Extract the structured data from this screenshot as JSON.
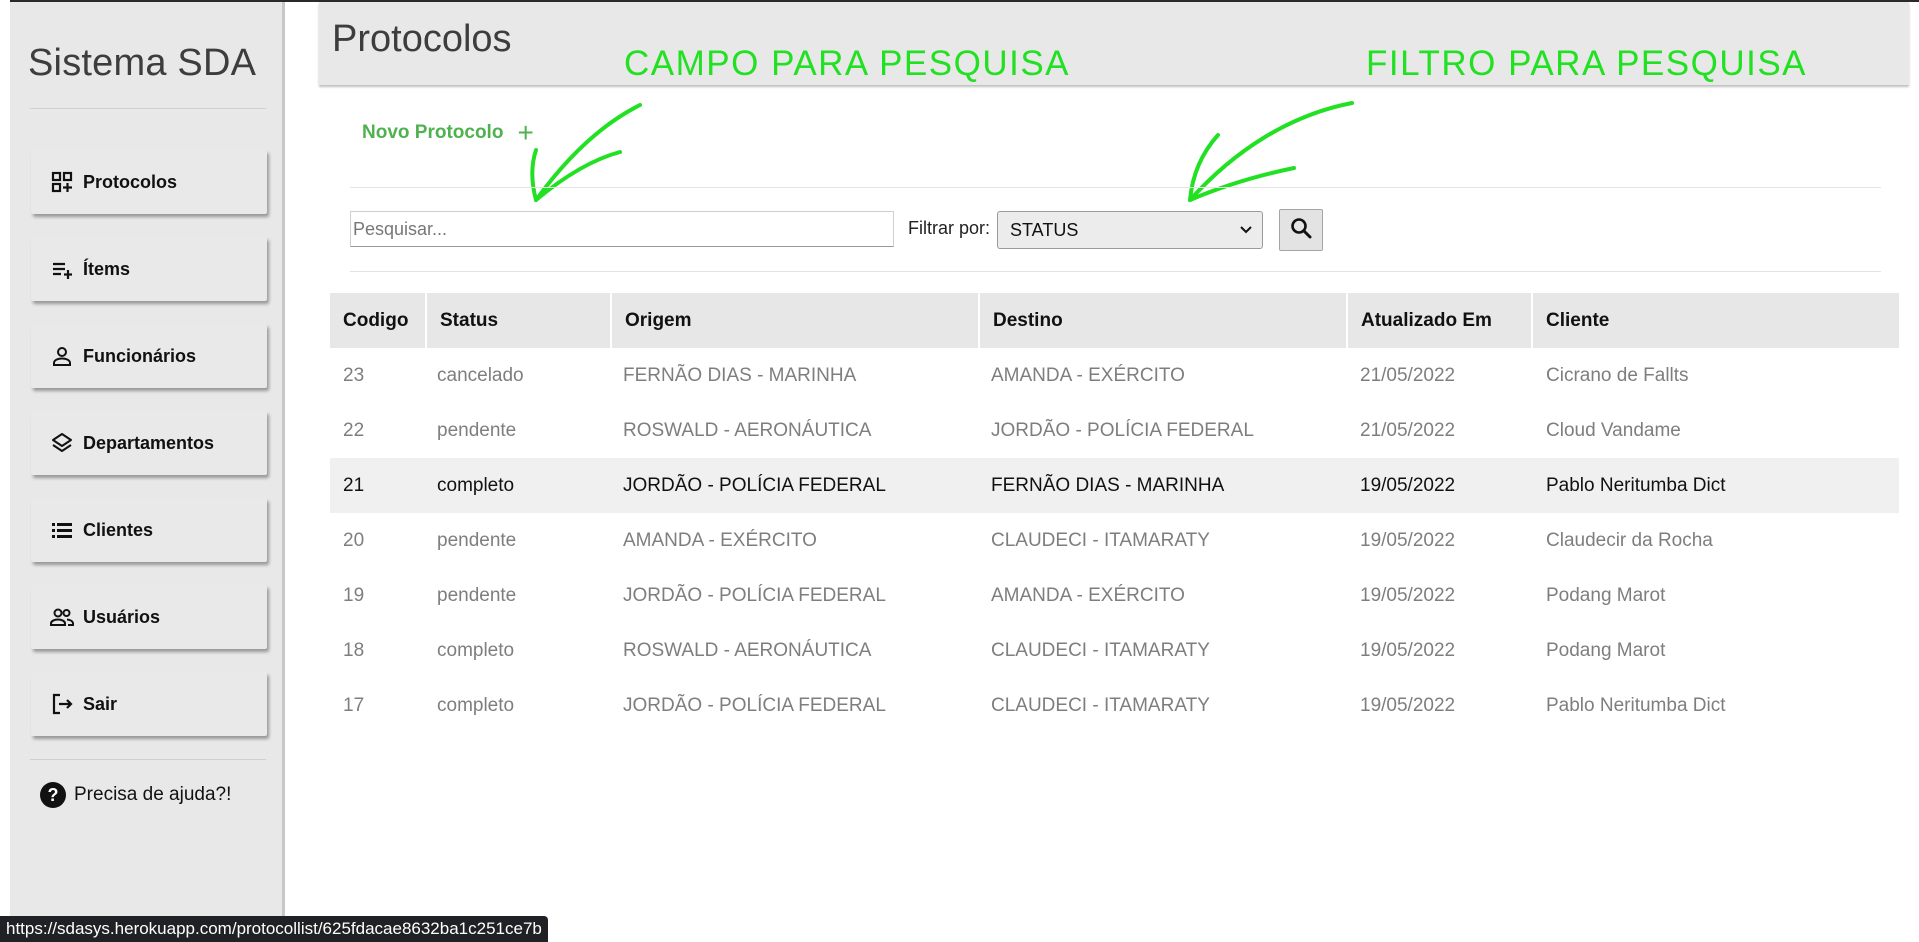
{
  "sidebar": {
    "brand": "Sistema SDA",
    "items": [
      {
        "label": "Protocolos"
      },
      {
        "label": "Ítems"
      },
      {
        "label": "Funcionários"
      },
      {
        "label": "Departamentos"
      },
      {
        "label": "Clientes"
      },
      {
        "label": "Usuários"
      },
      {
        "label": "Sair"
      }
    ],
    "help_label": "Precisa de ajuda?!"
  },
  "header": {
    "title": "Protocolos"
  },
  "annotations": {
    "search_field": "CAMPO PARA PESQUISA",
    "search_filter": "FILTRO PARA PESQUISA",
    "color": "#22e022"
  },
  "toolbar": {
    "new_protocol_label": "Novo Protocolo",
    "new_protocol_icon": "+",
    "search_placeholder": "Pesquisar...",
    "search_value": "",
    "filter_label": "Filtrar por:",
    "filter_value": "STATUS"
  },
  "table": {
    "columns": [
      "Codigo",
      "Status",
      "Origem",
      "Destino",
      "Atualizado Em",
      "Cliente"
    ],
    "rows": [
      {
        "codigo": "23",
        "status": "cancelado",
        "origem": "FERNÃO DIAS - MARINHA",
        "destino": "AMANDA - EXÉRCITO",
        "atualizado": "21/05/2022",
        "cliente": "Cicrano de Fallts"
      },
      {
        "codigo": "22",
        "status": "pendente",
        "origem": "ROSWALD - AERONÁUTICA",
        "destino": "JORDÃO - POLÍCIA FEDERAL",
        "atualizado": "21/05/2022",
        "cliente": "Cloud Vandame"
      },
      {
        "codigo": "21",
        "status": "completo",
        "origem": "JORDÃO - POLÍCIA FEDERAL",
        "destino": "FERNÃO DIAS - MARINHA",
        "atualizado": "19/05/2022",
        "cliente": "Pablo Neritumba Dict"
      },
      {
        "codigo": "20",
        "status": "pendente",
        "origem": "AMANDA - EXÉRCITO",
        "destino": "CLAUDECI - ITAMARATY",
        "atualizado": "19/05/2022",
        "cliente": "Claudecir da Rocha"
      },
      {
        "codigo": "19",
        "status": "pendente",
        "origem": "JORDÃO - POLÍCIA FEDERAL",
        "destino": "AMANDA - EXÉRCITO",
        "atualizado": "19/05/2022",
        "cliente": "Podang Marot"
      },
      {
        "codigo": "18",
        "status": "completo",
        "origem": "ROSWALD - AERONÁUTICA",
        "destino": "CLAUDECI - ITAMARATY",
        "atualizado": "19/05/2022",
        "cliente": "Podang Marot"
      },
      {
        "codigo": "17",
        "status": "completo",
        "origem": "JORDÃO - POLÍCIA FEDERAL",
        "destino": "CLAUDECI - ITAMARATY",
        "atualizado": "19/05/2022",
        "cliente": "Pablo Neritumba Dict"
      }
    ]
  },
  "statusbar": {
    "url": "https://sdasys.herokuapp.com/protocollist/625fdacae8632ba1c251ce7b"
  }
}
